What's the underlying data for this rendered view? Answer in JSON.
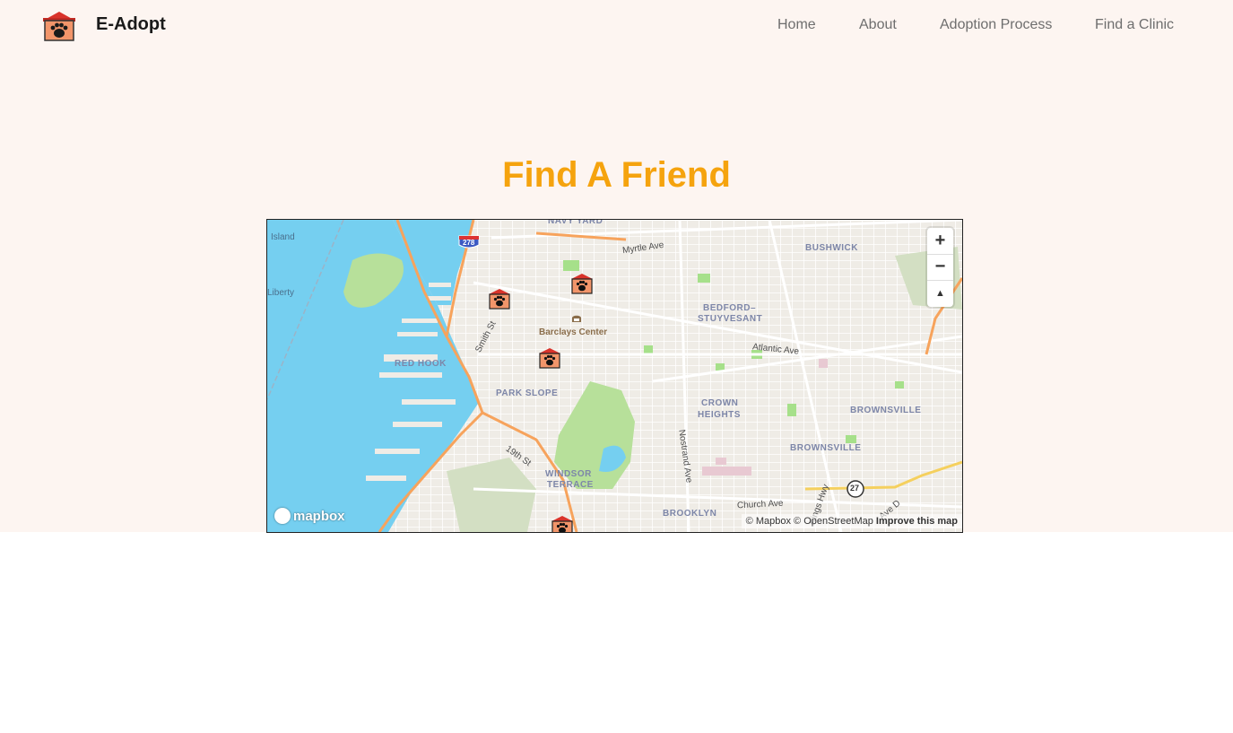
{
  "brand": {
    "name": "E-Adopt",
    "logo_icon": "paw-house-icon"
  },
  "nav": {
    "items": [
      {
        "label": "Home"
      },
      {
        "label": "About"
      },
      {
        "label": "Adoption Process"
      },
      {
        "label": "Find a Clinic"
      }
    ]
  },
  "hero": {
    "title": "Find A Friend"
  },
  "map": {
    "zoom_in": "+",
    "zoom_out": "−",
    "compass": "▲",
    "logo_text": "mapbox",
    "attribution": {
      "mapbox": "© Mapbox",
      "osm": "© OpenStreetMap",
      "improve": "Improve this map"
    },
    "labels": {
      "navy_yard": "NAVY YARD",
      "bushwick": "BUSHWICK",
      "island": "Island",
      "liberty": "Liberty",
      "myrtle": "Myrtle Ave",
      "bedford": "BEDFORD–",
      "stuyvesant": "STUYVESANT",
      "barclays": "Barclays Center",
      "smith": "Smith St",
      "atlantic": "Atlantic Ave",
      "red_hook": "RED HOOK",
      "park_slope": "PARK SLOPE",
      "crown": "CROWN",
      "heights": "HEIGHTS",
      "brownsville1": "BROWNSVILLE",
      "brownsville2": "BROWNSVILLE",
      "nineteenth": "19th St",
      "windsor": "WINDSOR",
      "terrace": "TERRACE",
      "nostrand": "Nostrand Ave",
      "church": "Church Ave",
      "brooklyn": "BROOKLYN",
      "kings_hwy": "Kings Hwy",
      "ave_d": "Ave D",
      "i278": "278",
      "r27": "27"
    }
  },
  "colors": {
    "accent": "#f5a30e",
    "page_bg": "#fdf5f1",
    "water": "#75cff0",
    "park": "#b7e09a",
    "highway": "#f7a35c"
  }
}
